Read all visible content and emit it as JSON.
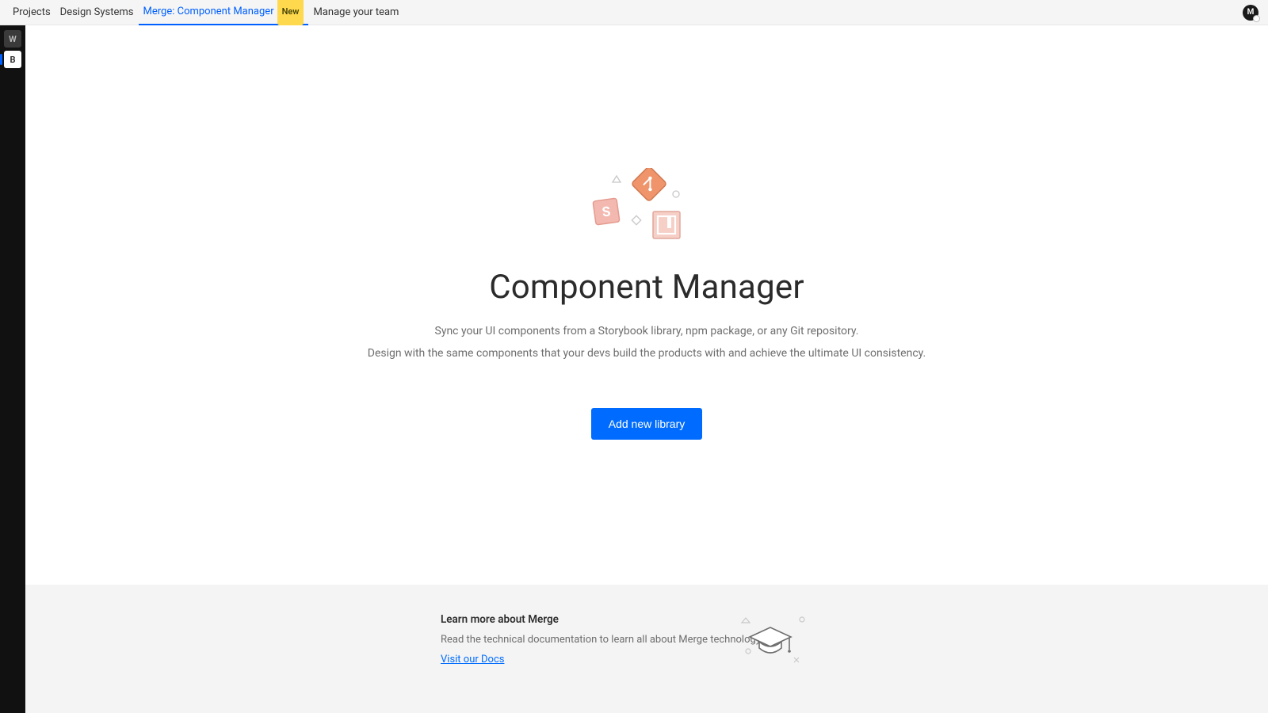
{
  "nav": {
    "items": [
      {
        "label": "Projects",
        "active": false,
        "badge": null
      },
      {
        "label": "Design Systems",
        "active": false,
        "badge": null
      },
      {
        "label": "Merge: Component Manager",
        "active": true,
        "badge": "New"
      },
      {
        "label": "Manage your team",
        "active": false,
        "badge": null
      }
    ],
    "avatar_initial": "M"
  },
  "rail": {
    "items": [
      {
        "glyph": "W",
        "variant": "dim"
      },
      {
        "glyph": "B",
        "variant": "lite"
      }
    ]
  },
  "hero": {
    "title": "Component Manager",
    "line1": "Sync your UI components from a Storybook library, npm package, or any Git repository.",
    "line2": "Design with the same components that your devs build the products with and achieve the ultimate UI consistency.",
    "cta_label": "Add new library"
  },
  "learn": {
    "heading": "Learn more about Merge",
    "body": "Read the technical documentation to learn all about Merge technology.",
    "link_label": "Visit our Docs"
  }
}
